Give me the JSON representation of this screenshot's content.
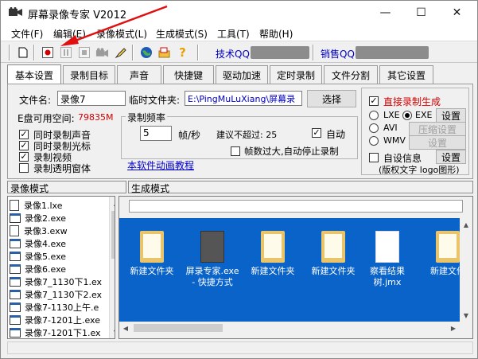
{
  "window": {
    "title": "屏幕录像专家 V2012",
    "controls": [
      "—",
      "☐",
      "✕"
    ]
  },
  "menu": [
    "文件(F)",
    "编辑(E)",
    "录像模式(L)",
    "生成模式(S)",
    "工具(T)",
    "帮助(H)"
  ],
  "toolbar": {
    "tech_qq_label": "技术QQ:",
    "sales_qq_label": "销售QQ:"
  },
  "tabs": [
    "基本设置",
    "录制目标",
    "声音",
    "快捷键",
    "驱动加速",
    "定时录制",
    "文件分割",
    "其它设置"
  ],
  "basic": {
    "filename_label": "文件名:",
    "filename_value": "录像7",
    "tempdir_label": "临时文件夹:",
    "tempdir_value": "E:\\PingMuLuXiang\\屏幕录",
    "browse_button": "选择",
    "disk_free_label": "E盘可用空间:",
    "disk_free_value": "79835M",
    "checks": [
      {
        "label": "同时录制声音",
        "checked": true
      },
      {
        "label": "同时录制光标",
        "checked": true
      },
      {
        "label": "录制视频",
        "checked": true
      },
      {
        "label": "录制透明窗体",
        "checked": false
      }
    ],
    "freq_group_label": "录制频率",
    "freq_value": "5",
    "freq_unit": "帧/秒",
    "suggest_label": "建议不超过: 25",
    "auto_label": "自动",
    "auto_checked": true,
    "auto_stop_label": "帧数过大,自动停止录制",
    "auto_stop_checked": false,
    "tutorial_link": "本软件动画教程"
  },
  "generate": {
    "direct_label": "直接录制生成",
    "direct_checked": true,
    "options": [
      {
        "label": "LXE",
        "selected": false
      },
      {
        "label": "EXE",
        "selected": true
      },
      {
        "label": "AVI",
        "selected": false
      },
      {
        "label": "WMV",
        "selected": false
      }
    ],
    "setting_button": "设置",
    "compress_button": "压缩设置",
    "setting_button_disabled": "设置",
    "custom_info_label": "自设信息",
    "custom_info_checked": false,
    "custom_setting_button": "设置",
    "copyright_note": "(版权文字 logo图形)"
  },
  "panes": {
    "record_mode": "录像模式",
    "generate_mode": "生成模式"
  },
  "files": [
    {
      "name": "录像1.lxe",
      "kind": "doc"
    },
    {
      "name": "录像2.exe",
      "kind": "movie"
    },
    {
      "name": "录像3.exw",
      "kind": "doc"
    },
    {
      "name": "录像4.exe",
      "kind": "movie"
    },
    {
      "name": "录像5.exe",
      "kind": "movie"
    },
    {
      "name": "录像6.exe",
      "kind": "movie"
    },
    {
      "name": "录像7_1130下1.ex",
      "kind": "movie"
    },
    {
      "name": "录像7_1130下2.ex",
      "kind": "movie"
    },
    {
      "name": "录像7-1130上午.e",
      "kind": "movie"
    },
    {
      "name": "录像7-1201上.exe",
      "kind": "movie"
    },
    {
      "name": "录像7-1201下1.ex",
      "kind": "movie"
    }
  ],
  "desktop": [
    {
      "label": "新建文件夹",
      "kind": "folder"
    },
    {
      "label": "屏录专家.exe - 快捷方式",
      "kind": "app"
    },
    {
      "label": "新建文件夹",
      "kind": "folder"
    },
    {
      "label": "新建文件夹",
      "kind": "folder"
    },
    {
      "label": "察看结果树.jmx",
      "kind": "file"
    },
    {
      "label": "新建文件",
      "kind": "folder"
    }
  ]
}
